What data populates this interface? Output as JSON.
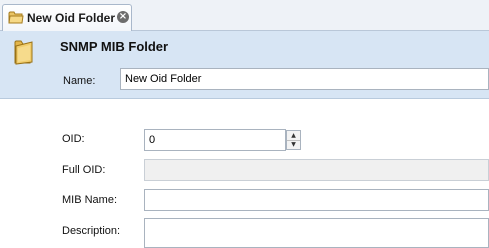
{
  "tab": {
    "title": "New Oid Folder",
    "close_icon": "close-icon",
    "icon": "folder-icon"
  },
  "header": {
    "title": "SNMP MIB Folder",
    "icon": "folder-icon",
    "name_label": "Name:",
    "name_value": "New Oid Folder"
  },
  "form": {
    "oid_label": "OID:",
    "oid_value": "0",
    "full_oid_label": "Full OID:",
    "full_oid_value": "",
    "mib_name_label": "MIB Name:",
    "mib_name_value": "",
    "description_label": "Description:",
    "description_value": ""
  },
  "colors": {
    "header_background": "#d7e5f4",
    "tab_strip": "#eef2f7"
  }
}
